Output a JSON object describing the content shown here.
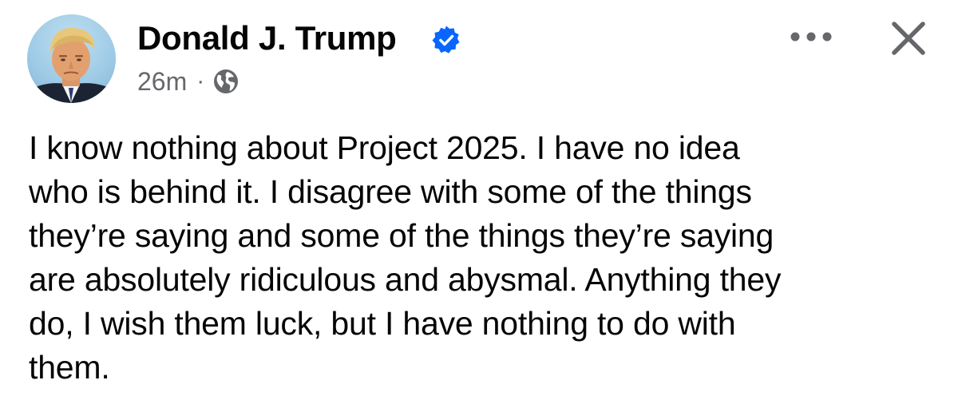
{
  "post": {
    "author": {
      "name": "Donald J. Trump",
      "verified": true,
      "avatar_icon": "profile-photo"
    },
    "timestamp": "26m",
    "separator": "·",
    "audience_icon": "globe-icon",
    "actions": {
      "more_icon": "more-dots-icon",
      "close_icon": "close-icon"
    },
    "text": "I know nothing about Project 2025. I have no idea\nwho is behind it. I disagree with some of the things\nthey’re saying and some of the things they’re saying\nare absolutely ridiculous and abysmal. Anything they\ndo, I wish them luck, but I have nothing to do with\nthem."
  },
  "colors": {
    "text": "#050505",
    "secondary_text": "#65676b",
    "verified_blue": "#0866ff",
    "background": "#ffffff"
  }
}
